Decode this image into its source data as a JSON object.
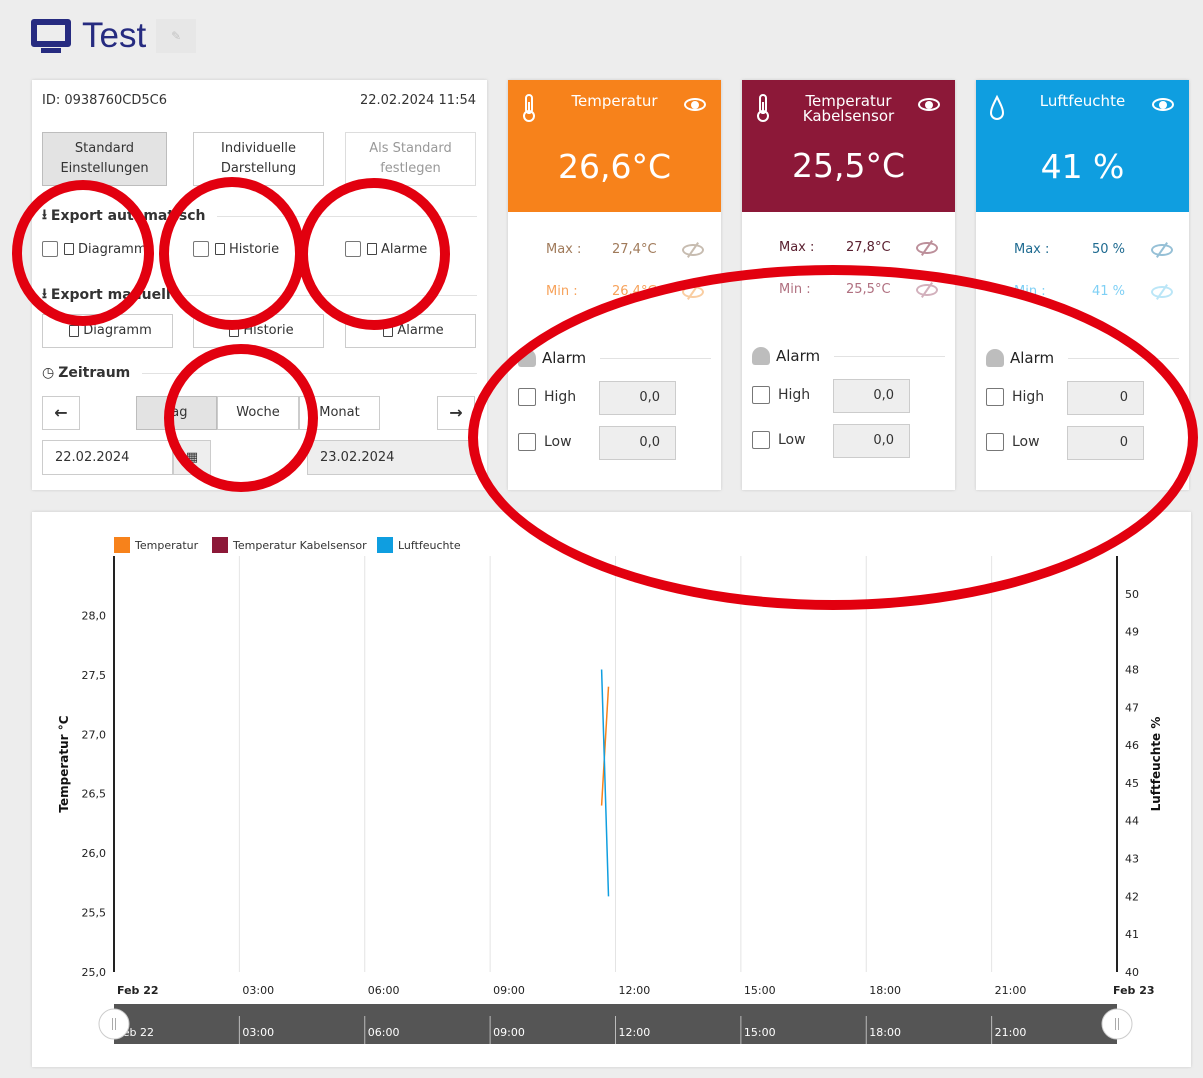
{
  "page": {
    "title": "Test"
  },
  "settings": {
    "device_id": "ID: 0938760CD5C6",
    "datetime": "22.02.2024 11:54",
    "buttons": {
      "standard": "Standard Einstellungen",
      "individual": "Individuelle Darstellung",
      "set_default": "Als Standard festlegen"
    },
    "export_auto": {
      "heading": "Export automatisch",
      "diagram": "Diagramm",
      "history": "Historie",
      "alarms": "Alarme"
    },
    "export_manual": {
      "heading": "Export manuell",
      "diagram": "Diagramm",
      "history": "Historie",
      "alarms": "Alarme"
    },
    "period": {
      "heading": "Zeitraum",
      "day": "Tag",
      "week": "Woche",
      "month": "Monat",
      "from": "22.02.2024",
      "to": "23.02.2024"
    }
  },
  "cards": [
    {
      "label": "Temperatur",
      "value": "26,6°C",
      "color": "#f7821b",
      "max_label": "Max :",
      "max_value": "27,4°C",
      "min_label": "Min :",
      "min_value": "26,4°C",
      "alarm_heading": "Alarm",
      "high_label": "High",
      "high_value": "0,0",
      "low_label": "Low",
      "low_value": "0,0"
    },
    {
      "label": "Temperatur Kabelsensor",
      "value": "25,5°C",
      "color": "#8c1838",
      "max_label": "Max :",
      "max_value": "27,8°C",
      "min_label": "Min :",
      "min_value": "25,5°C",
      "alarm_heading": "Alarm",
      "high_label": "High",
      "high_value": "0,0",
      "low_label": "Low",
      "low_value": "0,0"
    },
    {
      "label": "Luftfeuchte",
      "value": "41 %",
      "color": "#0f9ee0",
      "max_label": "Max :",
      "max_value": "50 %",
      "min_label": "Min :",
      "min_value": "41 %",
      "alarm_heading": "Alarm",
      "high_label": "High",
      "high_value": "0",
      "low_label": "Low",
      "low_value": "0"
    }
  ],
  "chart_data": {
    "type": "line",
    "legend": [
      "Temperatur",
      "Temperatur Kabelsensor",
      "Luftfeuchte"
    ],
    "legend_placement": "top-left",
    "grid": true,
    "ylabel": "Temperatur °C",
    "y2label": "Luftfeuchte %",
    "ylim": [
      25.0,
      28.5
    ],
    "y2lim": [
      40,
      51
    ],
    "yticks": [
      "25,0",
      "25,5",
      "26,0",
      "26,5",
      "27,0",
      "27,5",
      "28,0"
    ],
    "y2ticks": [
      "40",
      "41",
      "42",
      "43",
      "44",
      "45",
      "46",
      "47",
      "48",
      "49",
      "50"
    ],
    "xticks": [
      "Feb 22",
      "03:00",
      "06:00",
      "09:00",
      "12:00",
      "15:00",
      "18:00",
      "21:00",
      "Feb 23"
    ],
    "navigator_ticks": [
      "Feb 22",
      "03:00",
      "06:00",
      "09:00",
      "12:00",
      "15:00",
      "18:00",
      "21:00"
    ],
    "series": [
      {
        "name": "Temperatur",
        "color": "#f7821b",
        "axis": "left",
        "x": [
          "2024-02-22 11:40",
          "2024-02-22 11:50"
        ],
        "y": [
          26.4,
          27.4
        ]
      },
      {
        "name": "Luftfeuchte",
        "color": "#0f9ee0",
        "axis": "right",
        "x": [
          "2024-02-22 11:40",
          "2024-02-22 11:50"
        ],
        "y": [
          48,
          42
        ]
      }
    ]
  }
}
